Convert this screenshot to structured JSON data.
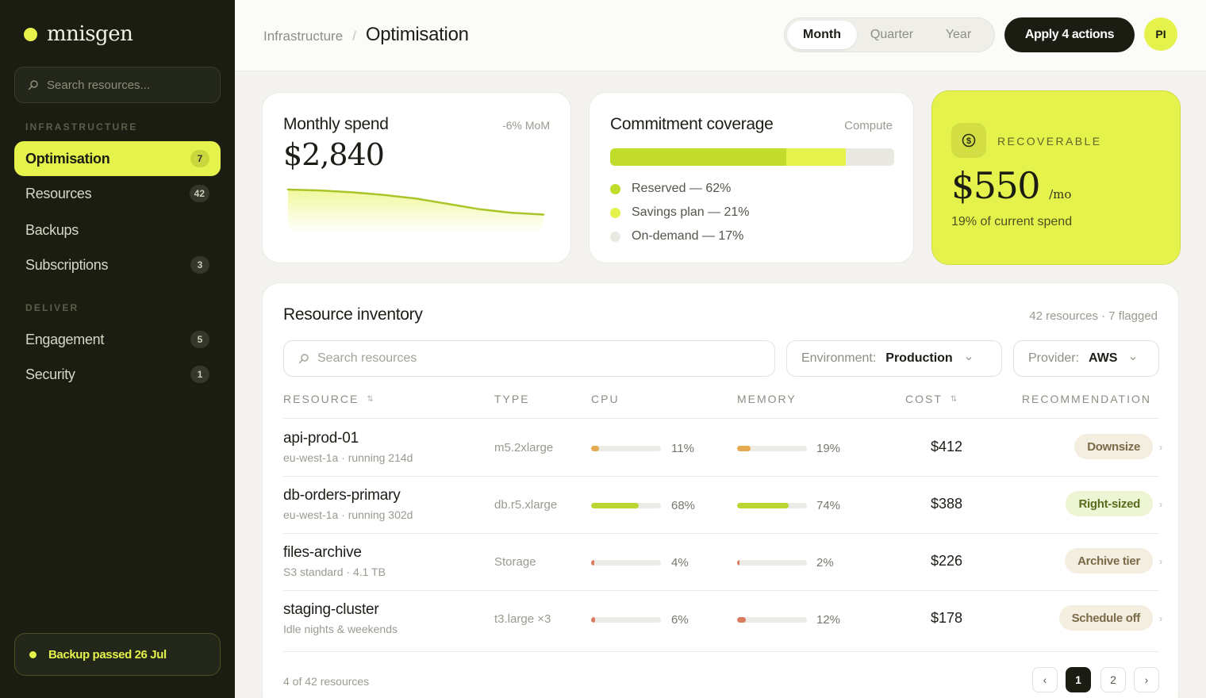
{
  "brand": {
    "name": "mnisgen"
  },
  "sidebar": {
    "search_placeholder": "Search resources...",
    "sections": [
      {
        "label": "INFRASTRUCTURE"
      },
      {
        "label": "DELIVER"
      }
    ],
    "items": [
      {
        "label": "Optimisation",
        "badge": "7",
        "active": true
      },
      {
        "label": "Resources",
        "badge": "42"
      },
      {
        "label": "Backups",
        "badge": ""
      },
      {
        "label": "Subscriptions",
        "badge": "3"
      },
      {
        "label": "Engagement",
        "badge": "5"
      },
      {
        "label": "Security",
        "badge": "1"
      }
    ],
    "status": "Backup passed 26 Jul"
  },
  "header": {
    "breadcrumb_parent": "Infrastructure",
    "breadcrumb_sep": "/",
    "title": "Optimisation",
    "periods": [
      "Month",
      "Quarter",
      "Year"
    ],
    "selected_period": "Month",
    "apply_label": "Apply 4 actions",
    "avatar_initials": "PI"
  },
  "spend": {
    "title": "Monthly spend",
    "delta": "-6% MoM",
    "amount": "$2,840",
    "trend": [
      100,
      99.5,
      98.5,
      97,
      95,
      92,
      89,
      87,
      86
    ]
  },
  "coverage": {
    "title": "Commitment coverage",
    "scope": "Compute",
    "segments": [
      {
        "label": "Reserved — 62%",
        "value": 62,
        "color": "#c2dc2c"
      },
      {
        "label": "Savings plan — 21%",
        "value": 21,
        "color": "#e4f24b"
      },
      {
        "label": "On-demand — 17%",
        "value": 17,
        "color": "#e9e8e1"
      }
    ]
  },
  "recoverable": {
    "label": "RECOVERABLE",
    "amount": "$550",
    "unit": "/mo",
    "subtitle": "19% of current spend",
    "icon": "dollar-icon"
  },
  "inventory": {
    "title": "Resource inventory",
    "summary": "42 resources · 7 flagged",
    "search_placeholder": "Search resources",
    "filters": [
      {
        "key": "Environment:",
        "value": "Production"
      },
      {
        "key": "Provider:",
        "value": "AWS"
      }
    ],
    "columns": [
      "RESOURCE",
      "TYPE",
      "CPU",
      "MEMORY",
      "COST",
      "RECOMMENDATION"
    ],
    "rows": [
      {
        "name": "api-prod-01",
        "sub": "eu-west-1a · running 214d",
        "type": "m5.2xlarge",
        "cpu": 11,
        "cpu_label": "11%",
        "mem": 19,
        "mem_label": "19%",
        "cost": "$412",
        "rec": "Downsize",
        "tone": "amber"
      },
      {
        "name": "db-orders-primary",
        "sub": "eu-west-1a · running 302d",
        "type": "db.r5.xlarge",
        "cpu": 68,
        "cpu_label": "68%",
        "mem": 74,
        "mem_label": "74%",
        "cost": "$388",
        "rec": "Right-sized",
        "tone": "green"
      },
      {
        "name": "files-archive",
        "sub": "S3 standard · 4.1 TB",
        "type": "Storage",
        "cpu": 4,
        "cpu_label": "4%",
        "mem": 2,
        "mem_label": "2%",
        "cost": "$226",
        "rec": "Archive tier",
        "tone": "red"
      },
      {
        "name": "staging-cluster",
        "sub": "Idle nights & weekends",
        "type": "t3.large ×3",
        "cpu": 6,
        "cpu_label": "6%",
        "mem": 12,
        "mem_label": "12%",
        "cost": "$178",
        "rec": "Schedule off",
        "tone": "red"
      }
    ],
    "footer": "4 of 42 resources",
    "pages": [
      "1",
      "2"
    ],
    "current_page": "1",
    "prev_symbol": "‹",
    "next_symbol": "›"
  },
  "colors": {
    "accent": "#e4f24b",
    "sidebar_bg": "#1b1d12",
    "amber": "#e5a94f",
    "green": "#b9d633",
    "red": "#d97a5f"
  }
}
